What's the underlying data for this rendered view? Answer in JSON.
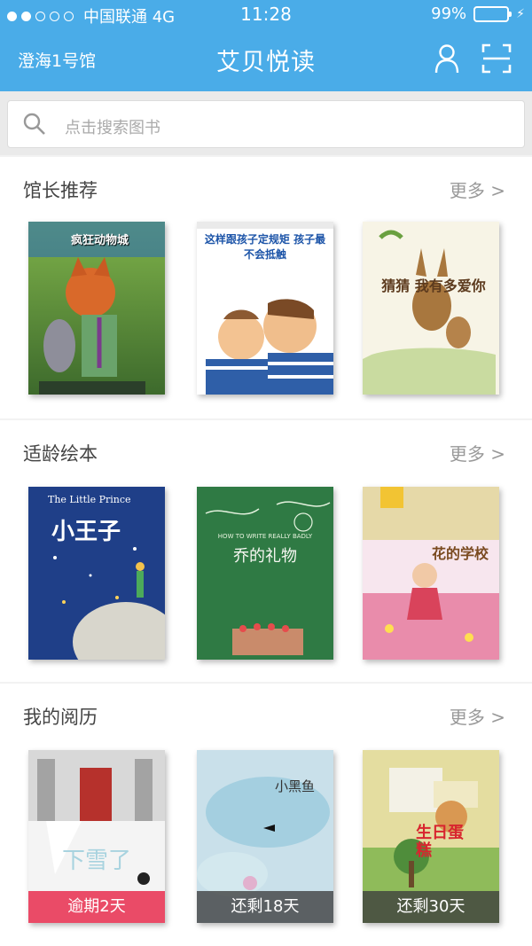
{
  "status_bar": {
    "carrier": "中国联通 4G",
    "time": "11:28",
    "battery": "99%"
  },
  "nav": {
    "branch": "澄海1号馆",
    "title": "艾贝悦读",
    "user_icon": "user-icon",
    "scan_icon": "scan-icon"
  },
  "search": {
    "placeholder": "点击搜索图书",
    "icon": "search-icon"
  },
  "sections": [
    {
      "title": "馆长推荐",
      "more": "更多 >",
      "books": [
        {
          "cover_title": "疯狂动物城"
        },
        {
          "cover_title": "这样跟孩子定规矩 孩子最不会抵触"
        },
        {
          "cover_title": "猜猜 我有多爱你"
        }
      ]
    },
    {
      "title": "适龄绘本",
      "more": "更多 >",
      "books": [
        {
          "cover_title": "小王子",
          "cover_subtitle": "The Little Prince"
        },
        {
          "cover_title": "乔的礼物",
          "cover_subtitle": "HOW TO WRITE REALLY BADLY"
        },
        {
          "cover_title": "花的学校"
        }
      ]
    },
    {
      "title": "我的阅历",
      "more": "更多 >",
      "books": [
        {
          "cover_title": "下雪了",
          "badge": "逾期2天"
        },
        {
          "cover_title": "小黑鱼",
          "badge": "还剩18天"
        },
        {
          "cover_title": "生日蛋糕",
          "badge": "还剩30天"
        }
      ]
    }
  ],
  "colors": {
    "header": "#4aace8",
    "overdue": "#e83c5a",
    "remaining": "#3c3c3c"
  }
}
